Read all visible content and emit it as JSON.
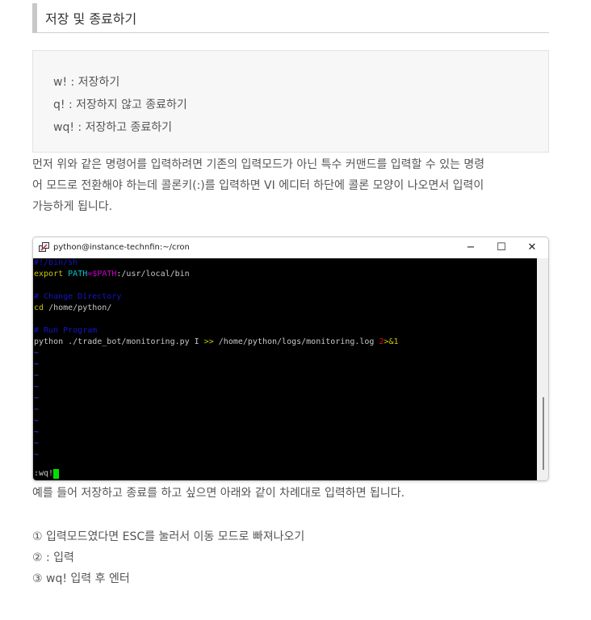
{
  "heading": "저장 및 종료하기",
  "commands": [
    "w! : 저장하기",
    "q! : 저장하지 않고 종료하기",
    "wq! : 저장하고 종료하기"
  ],
  "intro_lines": [
    "먼저 위와 같은 명령어를 입력하려면 기존의 입력모드가 아닌 특수 커맨드를 입력할 수 있는 명령",
    "어 모드로 전환해야 하는데 콜론키(:)를 입력하면 VI 에디터 하단에 콜론 모양이 나오면서 입력이",
    "가능하게 됩니다."
  ],
  "terminal": {
    "title": "python@instance-technfin:~/cron",
    "minimize": "−",
    "maximize": "☐",
    "close": "✕",
    "line_shebang": "#!/bin/sh",
    "export_kw": "export",
    "path_var": "PATH",
    "path_eq": "=",
    "path_ref": "$PATH",
    "path_rest": ":/usr/local/bin",
    "comment_dir": "# Change Directory",
    "cd_kw": "cd",
    "cd_arg": " /home/python/",
    "comment_run": "# Run Program",
    "run_cmd": "python ./trade_bot/monitoring.py I ",
    "run_redirect": ">>",
    "run_log": " /home/python/logs/monitoring.log ",
    "run_err": "2",
    "run_amp": ">&1",
    "tilde": "~",
    "command_line": ":wq!"
  },
  "after_text": "예를 들어 저장하고 종료를 하고 싶으면 아래와 같이 차례대로 입력하면 됩니다.",
  "steps": [
    "① 입력모드였다면 ESC를 눌러서 이동 모드로 빠져나오기",
    "② : 입력",
    "③ wq! 입력 후 엔터"
  ],
  "colors": {
    "terminal_bg": "#000000",
    "cursor": "#00e000",
    "comment": "#1414c8",
    "keyword": "#c8c800"
  }
}
